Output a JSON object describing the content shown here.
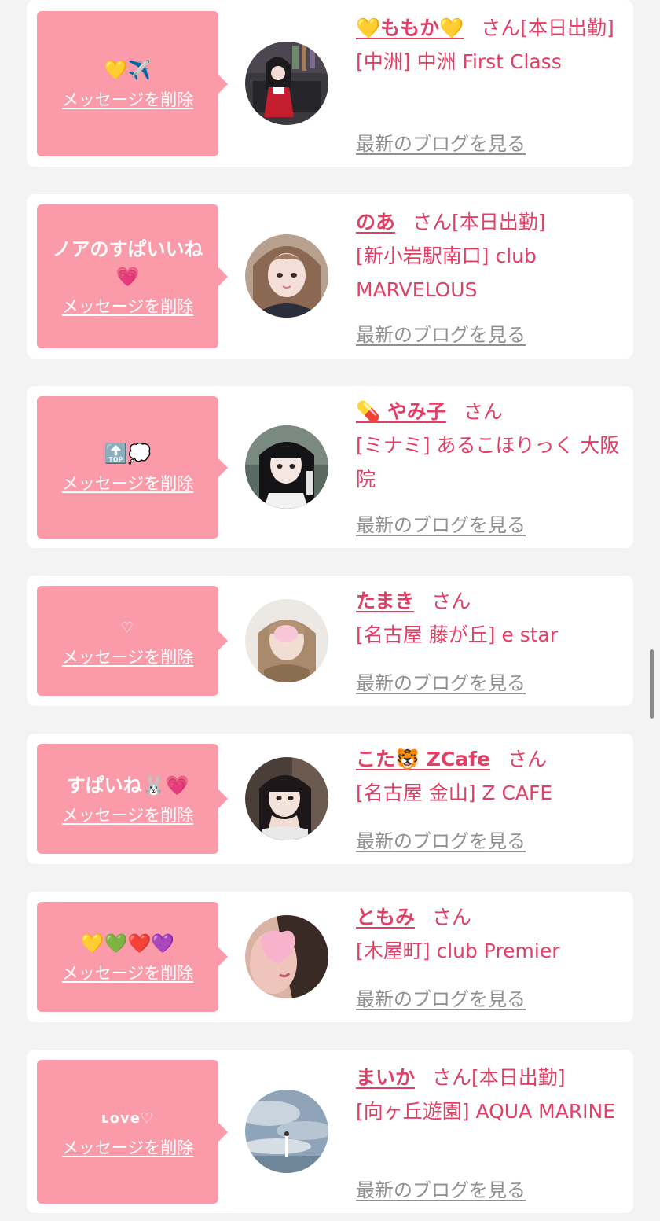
{
  "common": {
    "delete_label": "メッセージを削除",
    "blog_label": "最新のブログを見る",
    "san": "さん"
  },
  "items": [
    {
      "message": "💛✈️",
      "name": "💛ももか💛",
      "status": "[本日出勤]",
      "shop": "[中洲] 中洲 First Class"
    },
    {
      "message": "ノアのすぱいいね💗",
      "name": "のあ",
      "status": "[本日出勤]",
      "shop": "[新小岩駅南口] club MARVELOUS"
    },
    {
      "message": "🔝💭",
      "name": "💊 やみ子",
      "status": "",
      "shop": "[ミナミ] あるこほりっく 大阪院"
    },
    {
      "message": "♡",
      "name": "たまき",
      "status": "",
      "shop": "[名古屋 藤が丘] e star"
    },
    {
      "message": "すぱいね🐰💗",
      "name": "こた🐯 ZCafe",
      "status": "",
      "shop": "[名古屋 金山] Z CAFE"
    },
    {
      "message": "💛💚❤️💜",
      "name": "ともみ",
      "status": "",
      "shop": "[木屋町] club Premier"
    },
    {
      "message": "ʟove♡",
      "name": "まいか",
      "status": "[本日出勤]",
      "shop": "[向ヶ丘遊園] AQUA MARINE"
    }
  ],
  "colors": {
    "bubble": "#fb9aa8",
    "accent": "#e03f66",
    "muted": "#909090",
    "background": "#f3f3f3"
  }
}
